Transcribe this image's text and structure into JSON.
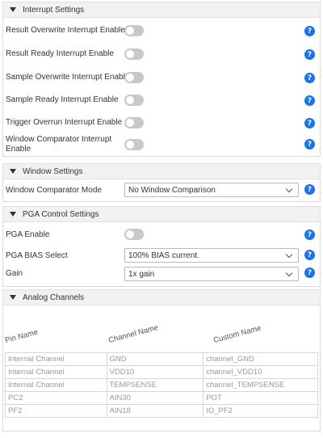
{
  "interrupt": {
    "title": "Interrupt Settings",
    "items": [
      {
        "label": "Result Overwrite Interrupt Enable"
      },
      {
        "label": "Result Ready Interrupt Enable"
      },
      {
        "label": "Sample Overwrite Interrupt Enable"
      },
      {
        "label": "Sample Ready Interrupt Enable"
      },
      {
        "label": "Trigger Overrun Interrupt Enable"
      },
      {
        "label": "Window Comparator Interrupt Enable"
      }
    ]
  },
  "window": {
    "title": "Window Settings",
    "mode_label": "Window Comparator Mode",
    "mode_value": "No Window Comparison"
  },
  "pga": {
    "title": "PGA Control Settings",
    "enable_label": "PGA Enable",
    "bias_label": "PGA BIAS Select",
    "bias_value": "100% BIAS current.",
    "gain_label": "Gain",
    "gain_value": "1x gain"
  },
  "analog": {
    "title": "Analog Channels",
    "headers": [
      "Pin Name",
      "Channel Name",
      "Custom Name"
    ],
    "rows": [
      [
        "Internal Channel",
        "GND",
        "channel_GND"
      ],
      [
        "Internal Channel",
        "VDD10",
        "channel_VDD10"
      ],
      [
        "Internal Channel",
        "TEMPSENSE",
        "channel_TEMPSENSE"
      ],
      [
        "PC2",
        "AIN30",
        "POT"
      ],
      [
        "PF2",
        "AIN18",
        "IO_PF2"
      ]
    ]
  },
  "icons": {
    "help": "?"
  },
  "colors": {
    "accent": "#1a73e8",
    "toggle_off": "#c8c8c8"
  }
}
